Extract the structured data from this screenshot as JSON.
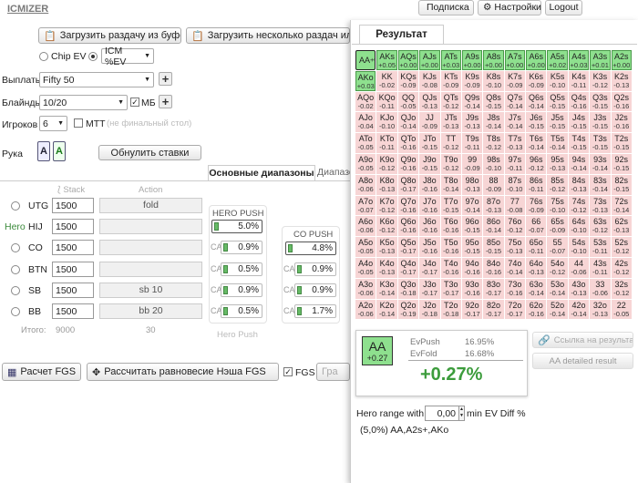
{
  "app": {
    "logo": "ICMIZER"
  },
  "topbar": {
    "subscription": "Подписка",
    "settings": "Настройки",
    "logout": "Logout"
  },
  "load": {
    "clipboard": "Загрузить раздачу из буфера",
    "multiple": "Загрузить несколько раздач или тур"
  },
  "mode": {
    "chip_ev": "Chip EV",
    "icm": "ICM %EV"
  },
  "payouts": {
    "label": "Выплаты",
    "value": "Fifty 50"
  },
  "blinds": {
    "label": "Блайнды",
    "value": "10/20",
    "mb": "МБ"
  },
  "players": {
    "label": "Игроков",
    "value": "6",
    "mtt": "MTT",
    "mtt_note": "(не финальный стол)"
  },
  "hand": {
    "label": "Рука",
    "card1": "A",
    "card2": "A",
    "reset": "Обнулить ставки"
  },
  "tabs": {
    "main": "Основные диапазоны",
    "second": "Диапазо"
  },
  "table": {
    "stack_h": "Stack",
    "action_h": "Action",
    "total_label": "Итого:",
    "total_stack": "9000",
    "total_action": "30",
    "rows": [
      {
        "pos": "UTG",
        "hero": "",
        "stack": "1500",
        "action": "fold"
      },
      {
        "pos": "HIJ",
        "hero": "Hero",
        "stack": "1500",
        "action": ""
      },
      {
        "pos": "CO",
        "hero": "",
        "stack": "1500",
        "action": ""
      },
      {
        "pos": "BTN",
        "hero": "",
        "stack": "1500",
        "action": ""
      },
      {
        "pos": "SB",
        "hero": "",
        "stack": "1500",
        "action": "sb 10"
      },
      {
        "pos": "BB",
        "hero": "",
        "stack": "1500",
        "action": "bb 20"
      }
    ]
  },
  "hero_push": {
    "title": "HERO PUSH",
    "value": "5.0%",
    "footer": "Hero Push",
    "ca": [
      "0.9%",
      "0.5%",
      "0.9%",
      "0.5%"
    ]
  },
  "co_push": {
    "title": "CO PUSH",
    "value": "4.8%",
    "ca": [
      "0.9%",
      "0.9%",
      "1.7%"
    ],
    "ca_label": "CA"
  },
  "bottom": {
    "fgs": "Расчет FGS",
    "nash": "Рассчитать равновесие Нэша FGS",
    "fgs_chk": "FGS",
    "gr": "Гра"
  },
  "result": {
    "tab": "Результат",
    "hand": "AA",
    "hand_ev": "+0.27",
    "evpush_l": "EvPush",
    "evpush": "16.95%",
    "evfold_l": "EvFold",
    "evfold": "16.68%",
    "diff": "+0.27%",
    "link": "Ссылка на результат",
    "detailed": "AA detailed result",
    "range_label": "Hero range with",
    "range_val": "0,00",
    "range_suffix": "min EV Diff %",
    "range_text": "(5,0%) AA,A2s+,AKo"
  },
  "matrix": [
    [
      "AA",
      "+0.27"
    ],
    [
      "AKs",
      "+0.05"
    ],
    [
      "AQs",
      "+0.00"
    ],
    [
      "AJs",
      "+0.00"
    ],
    [
      "ATs",
      "+0.03"
    ],
    [
      "A9s",
      "+0.00"
    ],
    [
      "A8s",
      "+0.00"
    ],
    [
      "A7s",
      "+0.00"
    ],
    [
      "A6s",
      "+0.00"
    ],
    [
      "A5s",
      "+0.02"
    ],
    [
      "A4s",
      "+0.03"
    ],
    [
      "A3s",
      "+0.01"
    ],
    [
      "A2s",
      "+0.00"
    ],
    [
      "AKo",
      "+0.03"
    ],
    [
      "KK",
      "-0.02"
    ],
    [
      "KQs",
      "-0.09"
    ],
    [
      "KJs",
      "-0.08"
    ],
    [
      "KTs",
      "-0.09"
    ],
    [
      "K9s",
      "-0.09"
    ],
    [
      "K8s",
      "-0.10"
    ],
    [
      "K7s",
      "-0.09"
    ],
    [
      "K6s",
      "-0.09"
    ],
    [
      "K5s",
      "-0.10"
    ],
    [
      "K4s",
      "-0.11"
    ],
    [
      "K3s",
      "-0.12"
    ],
    [
      "K2s",
      "-0.13"
    ],
    [
      "AQo",
      "-0.02"
    ],
    [
      "KQo",
      "-0.11"
    ],
    [
      "QQ",
      "-0.05"
    ],
    [
      "QJs",
      "-0.13"
    ],
    [
      "QTs",
      "-0.12"
    ],
    [
      "Q9s",
      "-0.14"
    ],
    [
      "Q8s",
      "-0.15"
    ],
    [
      "Q7s",
      "-0.14"
    ],
    [
      "Q6s",
      "-0.14"
    ],
    [
      "Q5s",
      "-0.15"
    ],
    [
      "Q4s",
      "-0.16"
    ],
    [
      "Q3s",
      "-0.15"
    ],
    [
      "Q2s",
      "-0.16"
    ],
    [
      "AJo",
      "-0.04"
    ],
    [
      "KJo",
      "-0.10"
    ],
    [
      "QJo",
      "-0.14"
    ],
    [
      "JJ",
      "-0.09"
    ],
    [
      "JTs",
      "-0.13"
    ],
    [
      "J9s",
      "-0.13"
    ],
    [
      "J8s",
      "-0.14"
    ],
    [
      "J7s",
      "-0.14"
    ],
    [
      "J6s",
      "-0.15"
    ],
    [
      "J5s",
      "-0.15"
    ],
    [
      "J4s",
      "-0.15"
    ],
    [
      "J3s",
      "-0.15"
    ],
    [
      "J2s",
      "-0.16"
    ],
    [
      "ATo",
      "-0.05"
    ],
    [
      "KTo",
      "-0.11"
    ],
    [
      "QTo",
      "-0.16"
    ],
    [
      "JTo",
      "-0.15"
    ],
    [
      "TT",
      "-0.12"
    ],
    [
      "T9s",
      "-0.11"
    ],
    [
      "T8s",
      "-0.12"
    ],
    [
      "T7s",
      "-0.13"
    ],
    [
      "T6s",
      "-0.14"
    ],
    [
      "T5s",
      "-0.14"
    ],
    [
      "T4s",
      "-0.15"
    ],
    [
      "T3s",
      "-0.15"
    ],
    [
      "T2s",
      "-0.15"
    ],
    [
      "A9o",
      "-0.05"
    ],
    [
      "K9o",
      "-0.12"
    ],
    [
      "Q9o",
      "-0.16"
    ],
    [
      "J9o",
      "-0.15"
    ],
    [
      "T9o",
      "-0.12"
    ],
    [
      "99",
      "-0.09"
    ],
    [
      "98s",
      "-0.10"
    ],
    [
      "97s",
      "-0.11"
    ],
    [
      "96s",
      "-0.12"
    ],
    [
      "95s",
      "-0.13"
    ],
    [
      "94s",
      "-0.14"
    ],
    [
      "93s",
      "-0.14"
    ],
    [
      "92s",
      "-0.15"
    ],
    [
      "A8o",
      "-0.06"
    ],
    [
      "K8o",
      "-0.13"
    ],
    [
      "Q8o",
      "-0.17"
    ],
    [
      "J8o",
      "-0.16"
    ],
    [
      "T8o",
      "-0.14"
    ],
    [
      "98o",
      "-0.13"
    ],
    [
      "88",
      "-0.09"
    ],
    [
      "87s",
      "-0.10"
    ],
    [
      "86s",
      "-0.11"
    ],
    [
      "85s",
      "-0.12"
    ],
    [
      "84s",
      "-0.13"
    ],
    [
      "83s",
      "-0.14"
    ],
    [
      "82s",
      "-0.15"
    ],
    [
      "A7o",
      "-0.07"
    ],
    [
      "K7o",
      "-0.12"
    ],
    [
      "Q7o",
      "-0.16"
    ],
    [
      "J7o",
      "-0.16"
    ],
    [
      "T7o",
      "-0.15"
    ],
    [
      "97o",
      "-0.14"
    ],
    [
      "87o",
      "-0.13"
    ],
    [
      "77",
      "-0.08"
    ],
    [
      "76s",
      "-0.09"
    ],
    [
      "75s",
      "-0.10"
    ],
    [
      "74s",
      "-0.12"
    ],
    [
      "73s",
      "-0.13"
    ],
    [
      "72s",
      "-0.14"
    ],
    [
      "A6o",
      "-0.06"
    ],
    [
      "K6o",
      "-0.12"
    ],
    [
      "Q6o",
      "-0.16"
    ],
    [
      "J6o",
      "-0.16"
    ],
    [
      "T6o",
      "-0.16"
    ],
    [
      "96o",
      "-0.15"
    ],
    [
      "86o",
      "-0.14"
    ],
    [
      "76o",
      "-0.12"
    ],
    [
      "66",
      "-0.07"
    ],
    [
      "65s",
      "-0.09"
    ],
    [
      "64s",
      "-0.10"
    ],
    [
      "63s",
      "-0.12"
    ],
    [
      "62s",
      "-0.13"
    ],
    [
      "A5o",
      "-0.05"
    ],
    [
      "K5o",
      "-0.13"
    ],
    [
      "Q5o",
      "-0.17"
    ],
    [
      "J5o",
      "-0.16"
    ],
    [
      "T5o",
      "-0.16"
    ],
    [
      "95o",
      "-0.15"
    ],
    [
      "85o",
      "-0.15"
    ],
    [
      "75o",
      "-0.13"
    ],
    [
      "65o",
      "-0.11"
    ],
    [
      "55",
      "-0.07"
    ],
    [
      "54s",
      "-0.10"
    ],
    [
      "53s",
      "-0.11"
    ],
    [
      "52s",
      "-0.12"
    ],
    [
      "A4o",
      "-0.05"
    ],
    [
      "K4o",
      "-0.13"
    ],
    [
      "Q4o",
      "-0.17"
    ],
    [
      "J4o",
      "-0.17"
    ],
    [
      "T4o",
      "-0.16"
    ],
    [
      "94o",
      "-0.16"
    ],
    [
      "84o",
      "-0.16"
    ],
    [
      "74o",
      "-0.14"
    ],
    [
      "64o",
      "-0.13"
    ],
    [
      "54o",
      "-0.12"
    ],
    [
      "44",
      "-0.06"
    ],
    [
      "43s",
      "-0.11"
    ],
    [
      "42s",
      "-0.12"
    ],
    [
      "A3o",
      "-0.06"
    ],
    [
      "K3o",
      "-0.14"
    ],
    [
      "Q3o",
      "-0.18"
    ],
    [
      "J3o",
      "-0.17"
    ],
    [
      "T3o",
      "-0.17"
    ],
    [
      "93o",
      "-0.16"
    ],
    [
      "83o",
      "-0.17"
    ],
    [
      "73o",
      "-0.16"
    ],
    [
      "63o",
      "-0.14"
    ],
    [
      "53o",
      "-0.14"
    ],
    [
      "43o",
      "-0.13"
    ],
    [
      "33",
      "-0.06"
    ],
    [
      "32s",
      "-0.12"
    ],
    [
      "A2o",
      "-0.06"
    ],
    [
      "K2o",
      "-0.14"
    ],
    [
      "Q2o",
      "-0.19"
    ],
    [
      "J2o",
      "-0.18"
    ],
    [
      "T2o",
      "-0.18"
    ],
    [
      "92o",
      "-0.17"
    ],
    [
      "82o",
      "-0.17"
    ],
    [
      "72o",
      "-0.17"
    ],
    [
      "62o",
      "-0.16"
    ],
    [
      "52o",
      "-0.14"
    ],
    [
      "42o",
      "-0.14"
    ],
    [
      "32o",
      "-0.13"
    ],
    [
      "22",
      "-0.05"
    ]
  ]
}
